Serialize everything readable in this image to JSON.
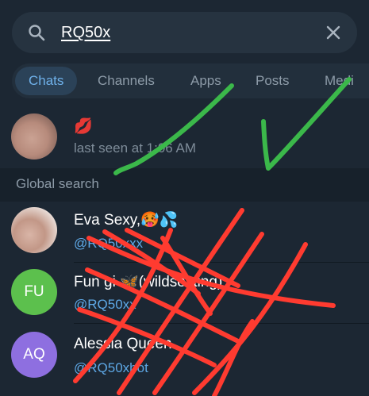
{
  "search": {
    "query": "RQ50x"
  },
  "tabs": [
    {
      "label": "Chats"
    },
    {
      "label": "Channels"
    },
    {
      "label": "Apps"
    },
    {
      "label": "Posts"
    },
    {
      "label": "Medi"
    }
  ],
  "local_result": {
    "title": "💋",
    "status": "last seen at 1:06 AM"
  },
  "global_header": "Global search",
  "global_results": [
    {
      "title": "Eva Sexy,🥵💦",
      "handle": "@RQ50xxx",
      "avatar": "photo"
    },
    {
      "title": "Fun gi 🦋(wildsexting)",
      "handle": "@RQ50xx",
      "avatar_initials": "FU",
      "avatar_color": "#5cc04d"
    },
    {
      "title": "Alessia Queen",
      "handle": "@RQ50xbot",
      "avatar_initials": "AQ",
      "avatar_color": "#8e6fe0"
    }
  ],
  "colors": {
    "accent": "#6fb1ea",
    "background": "#1c2733",
    "check_marks": "#3bb84a",
    "cross_marks": "#ff3b30"
  }
}
